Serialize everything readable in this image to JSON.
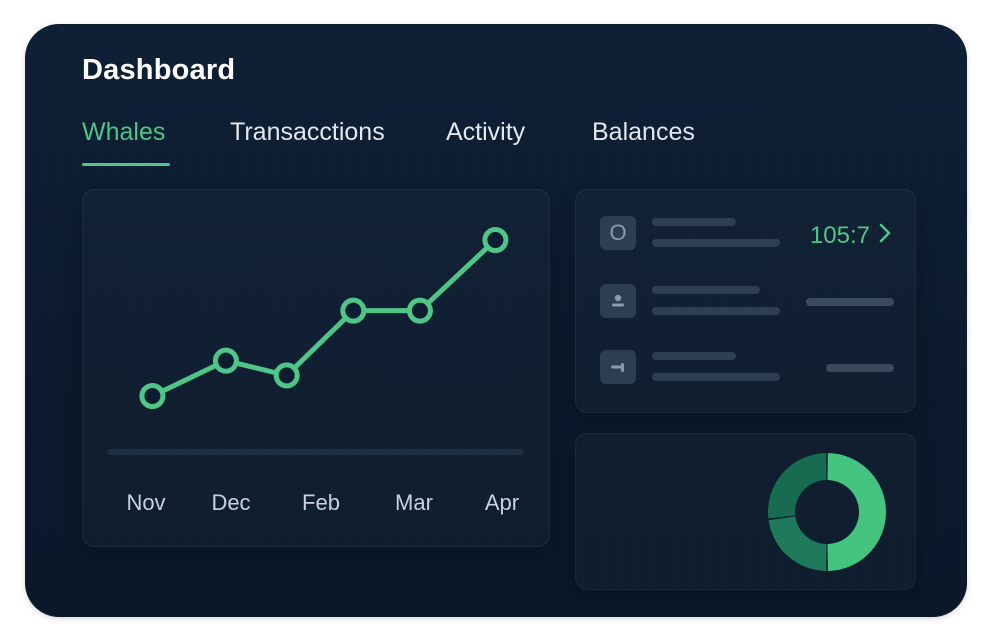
{
  "header": {
    "title": "Dashboard"
  },
  "tabs": [
    {
      "label": "Whales",
      "active": true
    },
    {
      "label": "Transacctions",
      "active": false
    },
    {
      "label": "Activity",
      "active": false
    },
    {
      "label": "Balances",
      "active": false
    }
  ],
  "chart_data": {
    "type": "line",
    "categories": [
      "Nov",
      "Dec",
      "Feb",
      "Mar",
      "Apr"
    ],
    "series": [
      {
        "color": "#4fc588",
        "values": [
          2.1,
          3.3,
          2.8,
          5.0,
          5.0,
          7.4
        ]
      }
    ],
    "point_x": [
      0.3,
      1.05,
      1.67,
      2.35,
      3.03,
      3.8
    ],
    "title": "",
    "xlabel": "",
    "ylabel": "",
    "grid": false
  },
  "list": {
    "items": [
      {
        "icon": "circle-o-icon",
        "icon_glyph": "O",
        "value": "105:7",
        "has_chevron": true
      },
      {
        "icon": "person-icon",
        "icon_glyph": "",
        "value": ""
      },
      {
        "icon": "arrow-right-icon",
        "icon_glyph": "",
        "value": ""
      }
    ]
  },
  "donut": {
    "segments": [
      {
        "fraction": 0.5,
        "color": "#45c47f"
      },
      {
        "fraction": 0.23,
        "color": "#1e7a5a"
      },
      {
        "fraction": 0.27,
        "color": "#176b50"
      }
    ]
  },
  "colors": {
    "accent": "#4fc588",
    "background": "#0b1a2d"
  }
}
